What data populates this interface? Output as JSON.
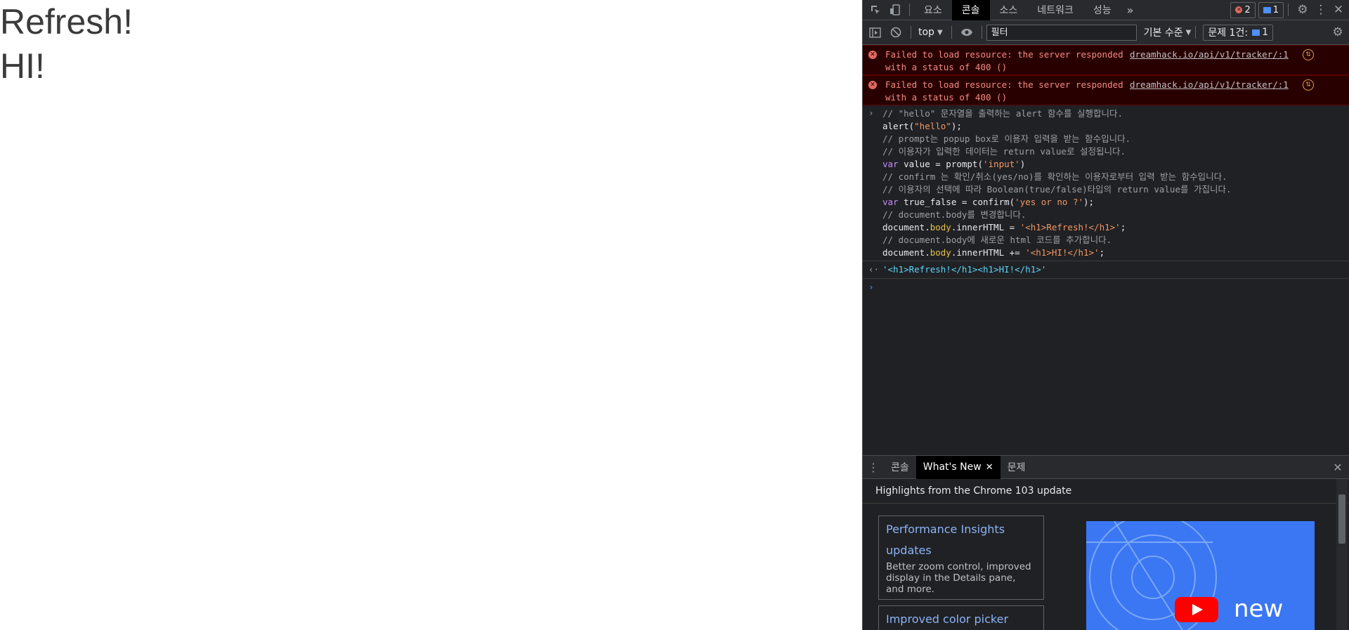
{
  "page": {
    "headings": [
      "Refresh!",
      "HI!"
    ]
  },
  "devtools": {
    "tabs": [
      "요소",
      "콘솔",
      "소스",
      "네트워크",
      "성능"
    ],
    "active_tab": "콘솔",
    "more_tabs": "»",
    "error_count": "2",
    "message_count": "1",
    "context": "top",
    "filter_placeholder": "필터",
    "level": "기본 수준",
    "issues_label": "문제 1건:",
    "issues_count": "1",
    "errors": [
      {
        "text": "Failed to load resource: the server responded with a status of 400 ()",
        "source": "dreamhack.io/api/v1/tracker/:1"
      },
      {
        "text": "Failed to load resource: the server responded with a status of 400 ()",
        "source": "dreamhack.io/api/v1/tracker/:1"
      }
    ],
    "code": {
      "l1": "// \"hello\" 문자열을 출력하는 alert 함수를 실행합니다.",
      "l2a": "alert(",
      "l2b": "\"hello\"",
      "l2c": ");",
      "l3": "// prompt는 popup box로 이용자 입력을 받는 함수입니다.",
      "l4": "// 이용자가 입력한 데이터는 return value로 설정됩니다.",
      "l5a": "var",
      "l5b": " value = prompt(",
      "l5c": "'input'",
      "l5d": ")",
      "l6": "// confirm 는 확인/취소(yes/no)를 확인하는 이용자로부터 입력 받는 함수입니다.",
      "l7": "// 이용자의 선택에 따라 Boolean(true/false)타입의 return value를 가집니다.",
      "l8a": "var",
      "l8b": " true_false = confirm(",
      "l8c": "'yes or no ?'",
      "l8d": ");",
      "l9": "// document.body를 변경합니다.",
      "l10a": "document.",
      "l10b": "body",
      "l10c": ".",
      "l10d": "innerHTML",
      "l10e": " = ",
      "l10f": "'<h1>Refresh!</h1>'",
      "l10g": ";",
      "l11": "// document.body에 새로운 html 코드를 추가합니다.",
      "l12a": "document.",
      "l12b": "body",
      "l12c": ".",
      "l12d": "innerHTML",
      "l12e": " += ",
      "l12f": "'<h1>HI!</h1>'",
      "l12g": ";"
    },
    "result": "'<h1>Refresh!</h1><h1>HI!</h1>'",
    "drawer": {
      "tabs": [
        "콘솔",
        "What's New",
        "문제"
      ],
      "active": "What's New",
      "highlights": "Highlights from the Chrome 103 update",
      "cards": [
        {
          "title": "Performance Insights updates",
          "desc": "Better zoom control, improved display in the Details pane, and more."
        },
        {
          "title": "Improved color picker",
          "desc": ""
        }
      ],
      "video_text": "new"
    }
  }
}
